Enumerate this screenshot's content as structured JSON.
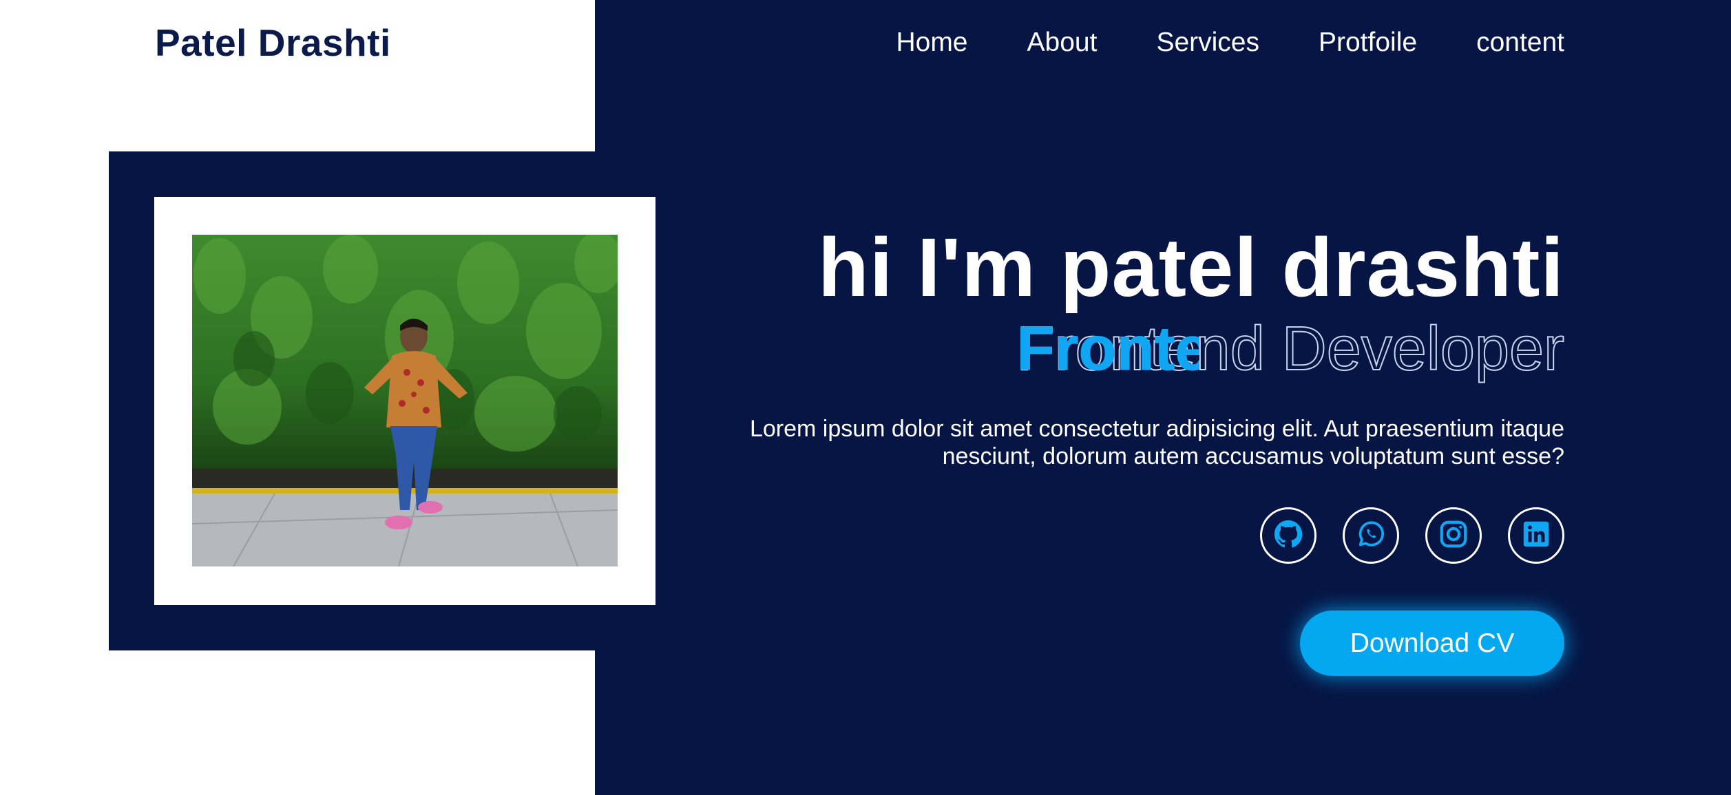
{
  "header": {
    "brand": "Patel Drashti",
    "nav": [
      "Home",
      "About",
      "Services",
      "Protfoile",
      "content"
    ]
  },
  "hero": {
    "title": "hi I'm patel drashti",
    "role": "Frontend Developer",
    "description": "Lorem ipsum dolor sit amet consectetur adipisicing elit. Aut praesentium itaque nesciunt, dolorum autem accusamus voluptatum sunt esse?",
    "download_label": "Download CV",
    "socials": [
      "github-icon",
      "whatsapp-icon",
      "instagram-icon",
      "linkedin-icon"
    ]
  },
  "colors": {
    "navy": "#061543",
    "accent": "#03a8f1",
    "text_light": "#ffffff"
  }
}
